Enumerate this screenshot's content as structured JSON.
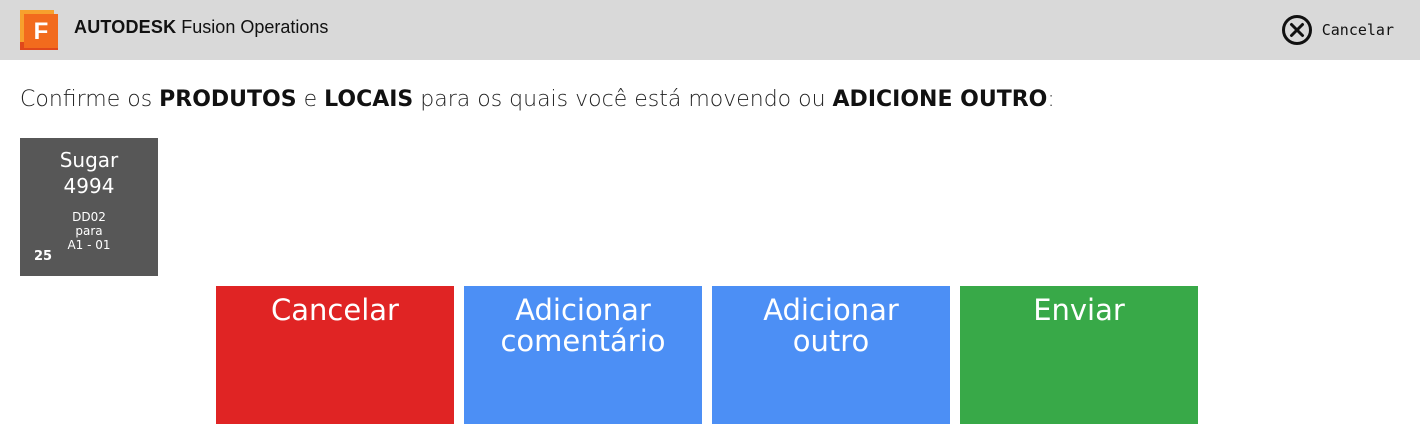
{
  "header": {
    "brand_strong": "AUTODESK",
    "brand_product": "Fusion Operations",
    "logo_letter": "F",
    "cancel_label": "Cancelar",
    "logo_colors": {
      "front": "#f26b1d",
      "back": "#e0481b"
    }
  },
  "instruction": {
    "part1": "Confirme os ",
    "bold1": "PRODUTOS",
    "part2": " e ",
    "bold2": "LOCAIS",
    "part3": " para os quais você está movendo ou ",
    "bold3": "ADICIONE OUTRO",
    "part4": ":"
  },
  "product_tile": {
    "name": "Sugar",
    "code": "4994",
    "from": "DD02",
    "connector": "para",
    "to": "A1 - 01",
    "quantity": "25"
  },
  "actions": {
    "cancel": {
      "line1": "Cancelar",
      "line2": "",
      "color": "#e02424"
    },
    "add_comment": {
      "line1": "Adicionar",
      "line2": "comentário",
      "color": "#4c8ff5"
    },
    "add_other": {
      "line1": "Adicionar",
      "line2": "outro",
      "color": "#4c8ff5"
    },
    "send": {
      "line1": "Enviar",
      "line2": "",
      "color": "#38a948"
    }
  },
  "icons": {
    "logo": "autodesk-fusion-logo-icon",
    "cancel": "close-circle-icon"
  }
}
